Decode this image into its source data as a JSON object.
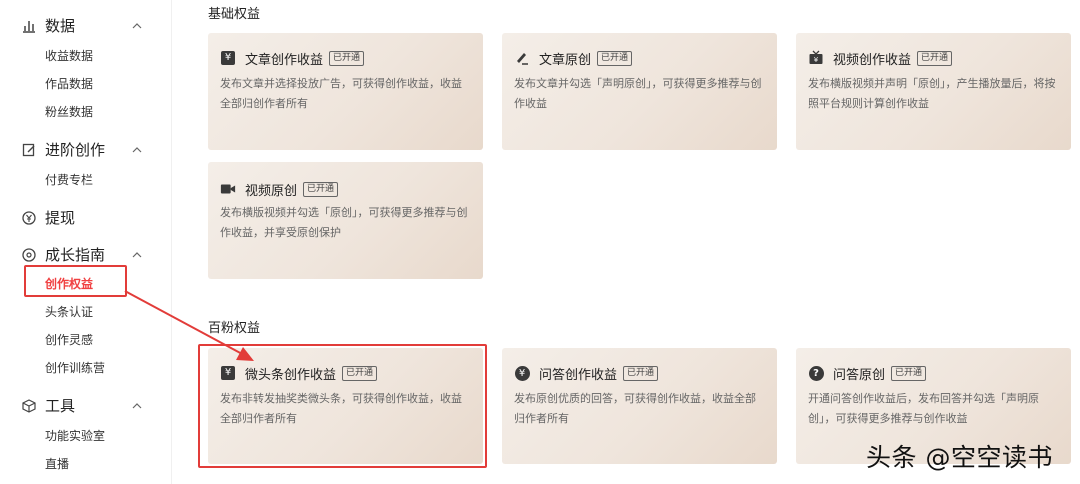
{
  "sidebar": {
    "groups": [
      {
        "title": "数据",
        "icon": "bar-chart-icon",
        "items": [
          "收益数据",
          "作品数据",
          "粉丝数据"
        ]
      },
      {
        "title": "进阶创作",
        "icon": "edit-icon",
        "items": [
          "付费专栏"
        ]
      },
      {
        "title": "提现",
        "icon": "yen-coin-icon",
        "items": []
      },
      {
        "title": "成长指南",
        "icon": "compass-icon",
        "items": [
          "创作权益",
          "头条认证",
          "创作灵感",
          "创作训练营"
        ]
      },
      {
        "title": "工具",
        "icon": "cube-icon",
        "items": [
          "功能实验室",
          "直播"
        ]
      }
    ],
    "active_item": "创作权益"
  },
  "sections": {
    "basic": {
      "title": "基础权益",
      "cards": [
        {
          "title": "文章创作收益",
          "badge": "已开通",
          "icon": "yen-square-icon",
          "desc": "发布文章并选择投放广告，可获得创作收益，收益全部归创作者所有"
        },
        {
          "title": "文章原创",
          "badge": "已开通",
          "icon": "pen-icon",
          "desc": "发布文章并勾选「声明原创」，可获得更多推荐与创作收益"
        },
        {
          "title": "视频创作收益",
          "badge": "已开通",
          "icon": "tv-icon",
          "desc": "发布横版视频并声明「原创」，产生播放量后，将按照平台规则计算创作收益"
        },
        {
          "title": "视频原创",
          "badge": "已开通",
          "icon": "video-camera-icon",
          "desc": "发布横版视频并勾选「原创」，可获得更多推荐与创作收益，并享受原创保护"
        }
      ]
    },
    "fans": {
      "title": "百粉权益",
      "cards": [
        {
          "title": "微头条创作收益",
          "badge": "已开通",
          "icon": "yen-square-icon",
          "desc": "发布非转发抽奖类微头条，可获得创作收益，收益全部归作者所有"
        },
        {
          "title": "问答创作收益",
          "badge": "已开通",
          "icon": "yen-circle-icon",
          "desc": "发布原创优质的回答，可获得创作收益，收益全部归作者所有"
        },
        {
          "title": "问答原创",
          "badge": "已开通",
          "icon": "question-icon",
          "desc": "开通问答创作收益后，发布回答并勾选「声明原创」，可获得更多推荐与创作收益"
        }
      ]
    }
  },
  "watermark": "头条 @空空读书",
  "colors": {
    "accent": "#f04142",
    "highlight": "#e23c39",
    "card_bg": "#efe5dc"
  }
}
